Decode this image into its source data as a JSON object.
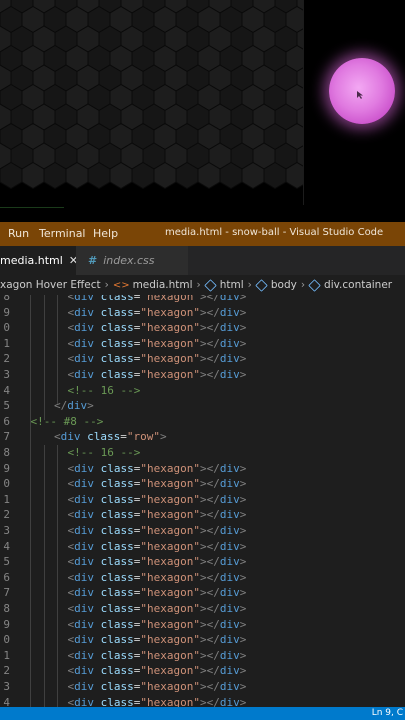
{
  "menu": {
    "run": "Run",
    "terminal": "Terminal",
    "help": "Help"
  },
  "window_title": "media.html - snow-ball - Visual Studio Code",
  "tabs": [
    {
      "label": "media.html",
      "active": true,
      "close": "✕"
    },
    {
      "label": "index.css",
      "icon": "#",
      "active": false
    }
  ],
  "breadcrumb": {
    "items": [
      "xagon Hover Effect",
      "media.html",
      "html",
      "body",
      "div.container"
    ],
    "separator": "›"
  },
  "code_lines": [
    {
      "num": "8",
      "indent": 7,
      "kind": "hex-top"
    },
    {
      "num": "9",
      "indent": 7,
      "kind": "hex"
    },
    {
      "num": "0",
      "indent": 7,
      "kind": "hex"
    },
    {
      "num": "1",
      "indent": 7,
      "kind": "hex"
    },
    {
      "num": "2",
      "indent": 7,
      "kind": "hex"
    },
    {
      "num": "3",
      "indent": 7,
      "kind": "hex"
    },
    {
      "num": "4",
      "indent": 7,
      "kind": "comment",
      "text": "<!-- 16 -->"
    },
    {
      "num": "5",
      "indent": 5,
      "kind": "close"
    },
    {
      "num": "6",
      "indent": 3,
      "kind": "comment",
      "text": "<!-- #8 -->"
    },
    {
      "num": "7",
      "indent": 5,
      "kind": "row"
    },
    {
      "num": "8",
      "indent": 7,
      "kind": "comment",
      "text": "<!-- 16 -->"
    },
    {
      "num": "9",
      "indent": 7,
      "kind": "hex"
    },
    {
      "num": "0",
      "indent": 7,
      "kind": "hex"
    },
    {
      "num": "1",
      "indent": 7,
      "kind": "hex"
    },
    {
      "num": "2",
      "indent": 7,
      "kind": "hex"
    },
    {
      "num": "3",
      "indent": 7,
      "kind": "hex"
    },
    {
      "num": "4",
      "indent": 7,
      "kind": "hex"
    },
    {
      "num": "5",
      "indent": 7,
      "kind": "hex"
    },
    {
      "num": "6",
      "indent": 7,
      "kind": "hex"
    },
    {
      "num": "7",
      "indent": 7,
      "kind": "hex"
    },
    {
      "num": "8",
      "indent": 7,
      "kind": "hex"
    },
    {
      "num": "9",
      "indent": 7,
      "kind": "hex"
    },
    {
      "num": "0",
      "indent": 7,
      "kind": "hex"
    },
    {
      "num": "1",
      "indent": 7,
      "kind": "hex"
    },
    {
      "num": "2",
      "indent": 7,
      "kind": "hex"
    },
    {
      "num": "3",
      "indent": 7,
      "kind": "hex"
    },
    {
      "num": "4",
      "indent": 7,
      "kind": "hex-bottom"
    }
  ],
  "code_tokens": {
    "tag_open": "<",
    "tag_end": ">",
    "close_open": "</",
    "tag": "div",
    "attr": "class",
    "eq": "=",
    "hex_value": "\"hexagon\"",
    "row_value": "\"row\""
  },
  "status": {
    "position": "Ln 9, C"
  },
  "colors": {
    "title_bar": "#7a4506",
    "status_bar": "#007acc",
    "editor_bg": "#1e1e1e",
    "ball": "#e07ae0"
  }
}
